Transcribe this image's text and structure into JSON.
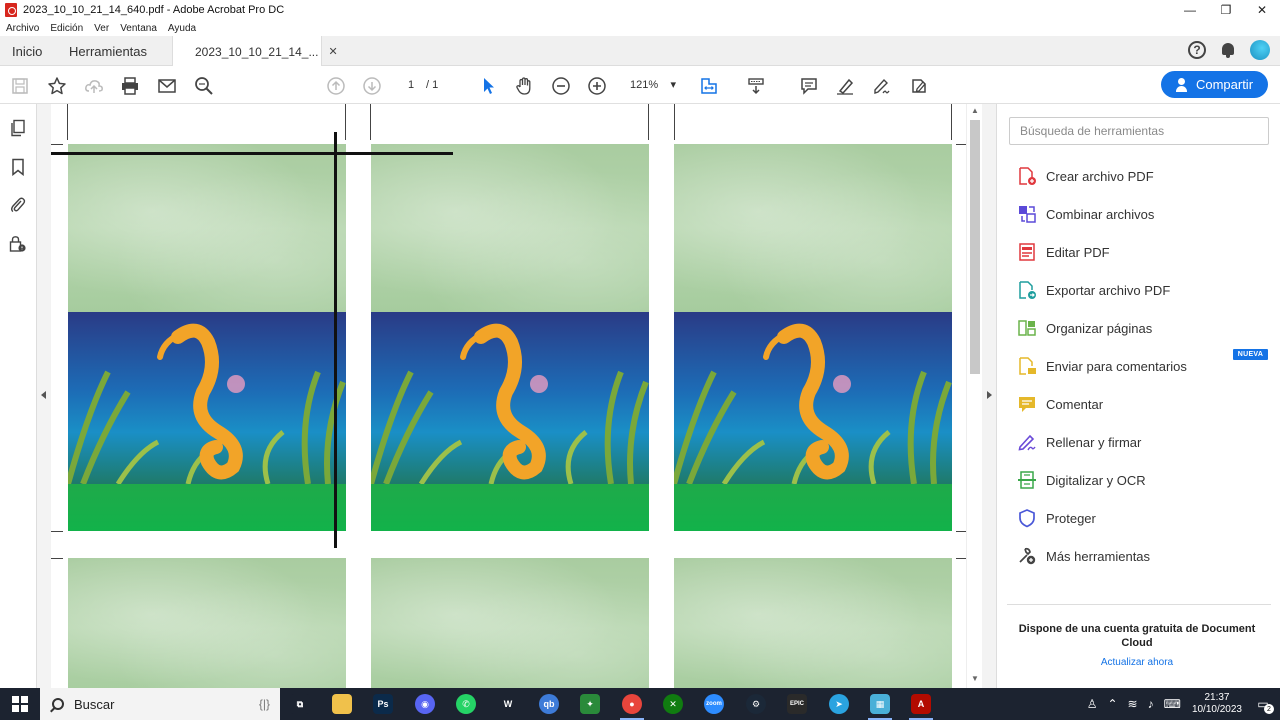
{
  "window": {
    "title": "2023_10_10_21_14_640.pdf - Adobe Acrobat Pro DC",
    "controls": {
      "minimize": "—",
      "restore": "❐",
      "close": "✕"
    }
  },
  "menu": [
    "Archivo",
    "Edición",
    "Ver",
    "Ventana",
    "Ayuda"
  ],
  "tabs": {
    "home": "Inicio",
    "tools": "Herramientas",
    "document": "2023_10_10_21_14_...",
    "document_close": "✕"
  },
  "header_icons": {
    "help": "?",
    "help_icon": "help-icon",
    "notifications_icon": "bell-icon",
    "avatar_icon": "avatar"
  },
  "toolbar": {
    "page_current": "1",
    "page_total": "/ 1",
    "zoom": "121%",
    "zoom_caret": "▾",
    "share_label": "Compartir"
  },
  "tool_panel": {
    "search_placeholder": "Búsqueda de herramientas",
    "items": [
      {
        "label": "Crear archivo PDF",
        "icon": "create-pdf-icon",
        "color": "#e0383e"
      },
      {
        "label": "Combinar archivos",
        "icon": "combine-files-icon",
        "color": "#5b4ad8"
      },
      {
        "label": "Editar PDF",
        "icon": "edit-pdf-icon",
        "color": "#e0383e"
      },
      {
        "label": "Exportar archivo PDF",
        "icon": "export-pdf-icon",
        "color": "#1f9e9e"
      },
      {
        "label": "Organizar páginas",
        "icon": "organize-pages-icon",
        "color": "#6ab34a"
      },
      {
        "label": "Enviar para comentarios",
        "icon": "send-comments-icon",
        "color": "#e5b82a"
      },
      {
        "label": "Comentar",
        "icon": "comment-icon",
        "color": "#e5b82a"
      },
      {
        "label": "Rellenar y firmar",
        "icon": "fill-sign-icon",
        "color": "#6a4ad8"
      },
      {
        "label": "Digitalizar y OCR",
        "icon": "scan-ocr-icon",
        "color": "#3aa84a"
      },
      {
        "label": "Proteger",
        "icon": "protect-icon",
        "color": "#4a58d8"
      },
      {
        "label": "Más herramientas",
        "icon": "more-tools-icon",
        "color": "#444444"
      }
    ],
    "new_badge": "NUEVA",
    "promo_text": "Dispone de una cuenta gratuita de Document Cloud",
    "upgrade_link": "Actualizar ahora"
  },
  "taskbar": {
    "search_label": "Buscar",
    "search_deco": "{|}",
    "time": "21:37",
    "date": "10/10/2023",
    "notification_count": "2",
    "apps": [
      {
        "name": "task-view",
        "label": "⧉",
        "color": "#1c2330"
      },
      {
        "name": "file-explorer",
        "label": "",
        "color": "#f0c14b"
      },
      {
        "name": "photoshop",
        "label": "Ps",
        "color": "#0b2a4a"
      },
      {
        "name": "discord",
        "label": "◉",
        "color": "#5865f2"
      },
      {
        "name": "whatsapp",
        "label": "✆",
        "color": "#25d366"
      },
      {
        "name": "winamp-w",
        "label": "W",
        "color": "#a83fc7"
      },
      {
        "name": "qbittorrent",
        "label": "qb",
        "color": "#3d7bd8"
      },
      {
        "name": "game-app",
        "label": "✦",
        "color": "#2a8a3a"
      },
      {
        "name": "chrome",
        "label": "●",
        "color": "#e8453c"
      },
      {
        "name": "xbox",
        "label": "✕",
        "color": "#107c10"
      },
      {
        "name": "zoom",
        "label": "zoom",
        "color": "#2d8cff"
      },
      {
        "name": "steam",
        "label": "⚙",
        "color": "#1b2838"
      },
      {
        "name": "epic-games",
        "label": "EPIC",
        "color": "#2a2a2a"
      },
      {
        "name": "telegram",
        "label": "➤",
        "color": "#2aa3e0"
      },
      {
        "name": "map-app",
        "label": "▦",
        "color": "#4ab0d8"
      },
      {
        "name": "acrobat",
        "label": "A",
        "color": "#b30b00"
      }
    ]
  },
  "colors": {
    "accent": "#1473e6",
    "taskbar": "#1c2330"
  }
}
